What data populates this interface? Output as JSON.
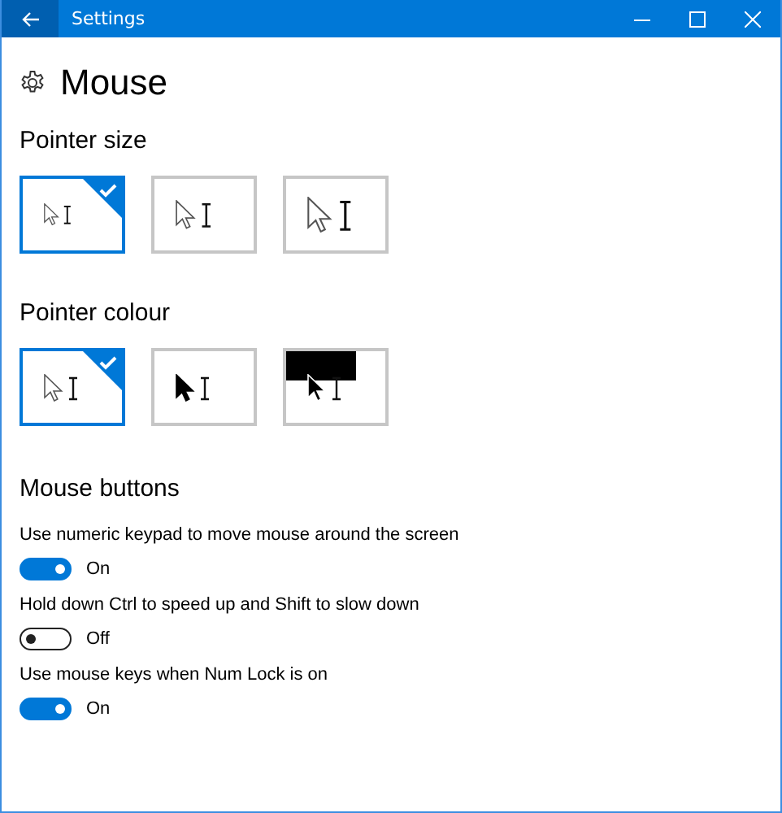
{
  "window": {
    "title": "Settings"
  },
  "page": {
    "title": "Mouse"
  },
  "pointer_size": {
    "heading": "Pointer size",
    "options": [
      {
        "kind": "small",
        "selected": true
      },
      {
        "kind": "medium",
        "selected": false
      },
      {
        "kind": "large",
        "selected": false
      }
    ]
  },
  "pointer_colour": {
    "heading": "Pointer colour",
    "options": [
      {
        "kind": "white",
        "selected": true
      },
      {
        "kind": "black",
        "selected": false
      },
      {
        "kind": "inverted",
        "selected": false
      }
    ]
  },
  "mouse_buttons": {
    "heading": "Mouse buttons",
    "settings": [
      {
        "label": "Use numeric keypad to move mouse around the screen",
        "on": true,
        "state": "On"
      },
      {
        "label": "Hold down Ctrl to speed up and Shift to slow down",
        "on": false,
        "state": "Off"
      },
      {
        "label": "Use mouse keys when Num Lock is on",
        "on": true,
        "state": "On"
      }
    ]
  }
}
